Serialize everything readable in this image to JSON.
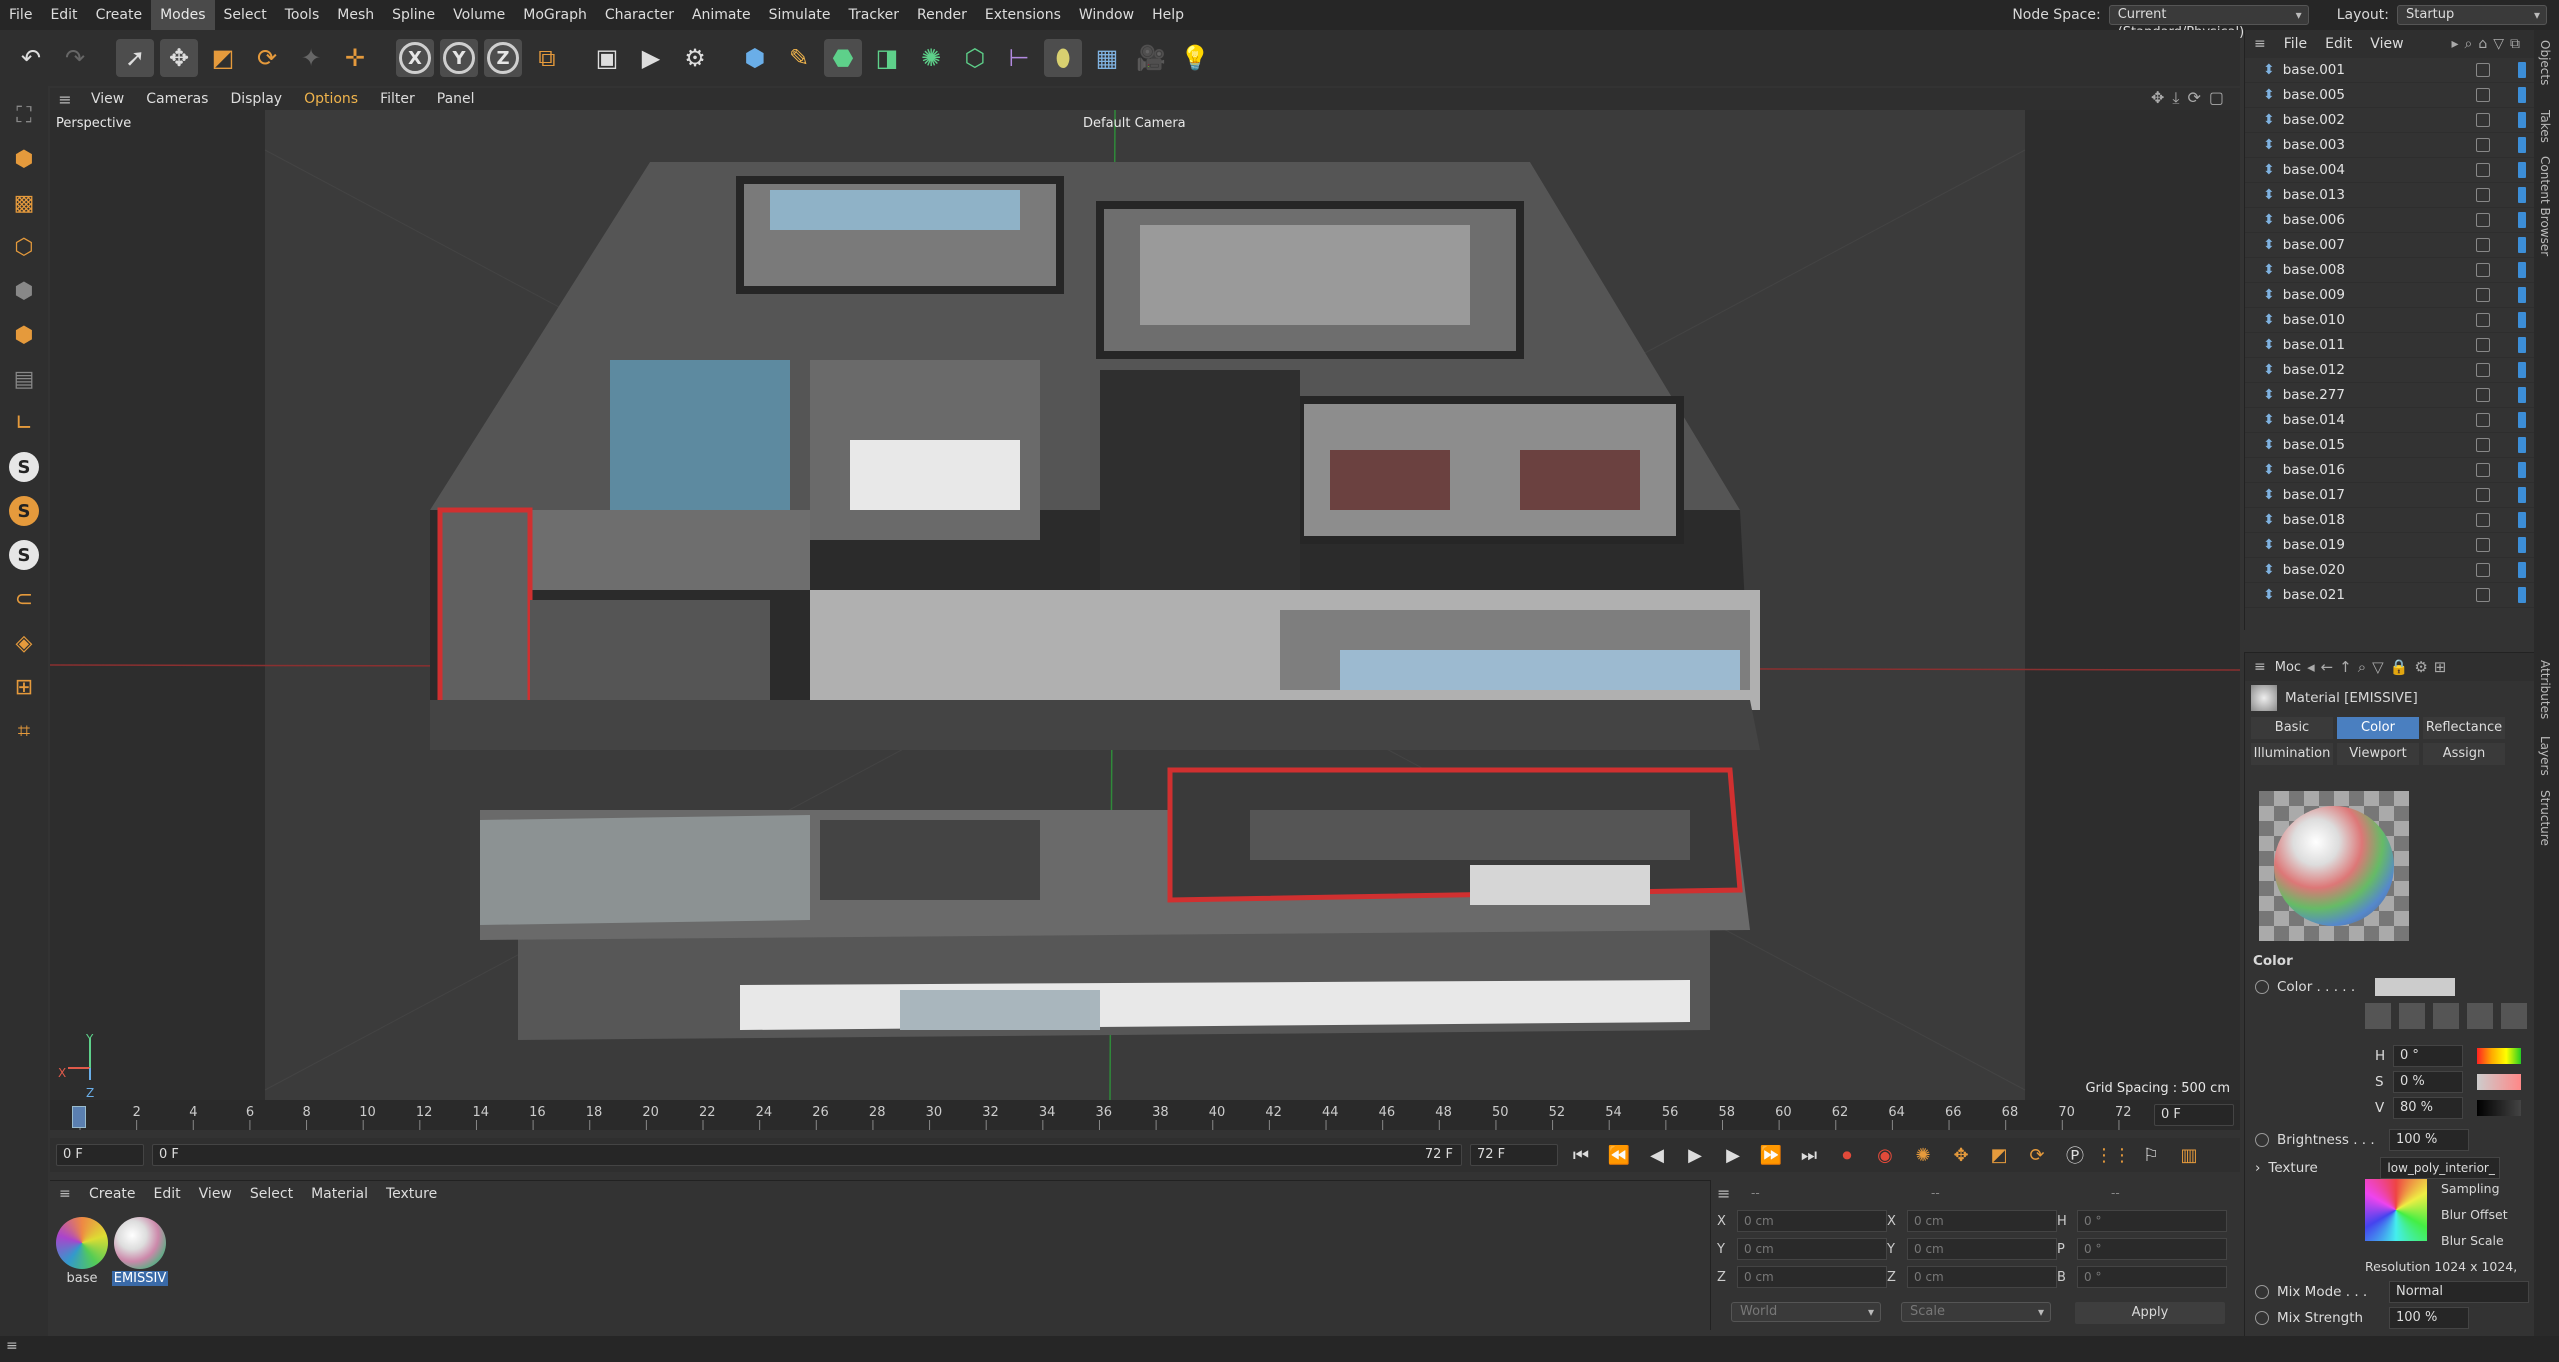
{
  "menu": {
    "items": [
      "File",
      "Edit",
      "Create",
      "Modes",
      "Select",
      "Tools",
      "Mesh",
      "Spline",
      "Volume",
      "MoGraph",
      "Character",
      "Animate",
      "Simulate",
      "Tracker",
      "Render",
      "Extensions",
      "Window",
      "Help"
    ],
    "active_index": 3,
    "node_space_label": "Node Space:",
    "node_space_value": "Current (Standard/Physical)",
    "layout_label": "Layout:",
    "layout_value": "Startup"
  },
  "viewport": {
    "menu": [
      "View",
      "Cameras",
      "Display",
      "Options",
      "Filter",
      "Panel"
    ],
    "highlight_index": 3,
    "view_name": "Perspective",
    "camera_name": "Default Camera",
    "grid_spacing": "Grid Spacing : 500 cm"
  },
  "timeline": {
    "ticks": [
      "0",
      "2",
      "4",
      "6",
      "8",
      "10",
      "12",
      "14",
      "16",
      "18",
      "20",
      "22",
      "24",
      "26",
      "28",
      "30",
      "32",
      "34",
      "36",
      "38",
      "40",
      "42",
      "44",
      "46",
      "48",
      "50",
      "52",
      "54",
      "56",
      "58",
      "60",
      "62",
      "64",
      "66",
      "68",
      "70",
      "72"
    ],
    "current_frame": "0 F",
    "start_frame": "0 F",
    "start_frame2": "0 F",
    "end_frame": "72 F",
    "end_frame2": "72 F"
  },
  "material_manager": {
    "menu": [
      "Create",
      "Edit",
      "View",
      "Select",
      "Material",
      "Texture"
    ],
    "materials": [
      {
        "name": "base",
        "selected": false
      },
      {
        "name": "EMISSIV",
        "selected": true
      }
    ]
  },
  "coordinates": {
    "header": "--",
    "header2": "--",
    "header3": "--",
    "pos": [
      {
        "axis": "X",
        "value": "0 cm"
      },
      {
        "axis": "Y",
        "value": "0 cm"
      },
      {
        "axis": "Z",
        "value": "0 cm"
      }
    ],
    "size": [
      {
        "axis": "X",
        "value": "0 cm"
      },
      {
        "axis": "Y",
        "value": "0 cm"
      },
      {
        "axis": "Z",
        "value": "0 cm"
      }
    ],
    "rot": [
      {
        "axis": "H",
        "value": "0 °"
      },
      {
        "axis": "P",
        "value": "0 °"
      },
      {
        "axis": "B",
        "value": "0 °"
      }
    ],
    "mode1": "World",
    "mode2": "Scale",
    "apply_label": "Apply"
  },
  "object_manager": {
    "menu": [
      "File",
      "Edit",
      "View"
    ],
    "objects": [
      "base.001",
      "base.005",
      "base.002",
      "base.003",
      "base.004",
      "base.013",
      "base.006",
      "base.007",
      "base.008",
      "base.009",
      "base.010",
      "base.011",
      "base.012",
      "base.277",
      "base.014",
      "base.015",
      "base.016",
      "base.017",
      "base.018",
      "base.019",
      "base.020",
      "base.021"
    ]
  },
  "attributes": {
    "mode_label": "Moc",
    "title": "Material [EMISSIVE]",
    "tabs": [
      "Basic",
      "Color",
      "Reflectance",
      "Illumination",
      "Viewport",
      "Assign"
    ],
    "selected_tab": 1,
    "section": "Color",
    "color_label": "Color . . . . .",
    "h_label": "H",
    "h_value": "0 °",
    "s_label": "S",
    "s_value": "0 %",
    "v_label": "V",
    "v_value": "80 %",
    "brightness_label": "Brightness . . .",
    "brightness_value": "100 %",
    "texture_label": "Texture",
    "texture_value": "low_poly_interior_",
    "sampling": "Sampling",
    "blur_offset": "Blur Offset",
    "blur_scale": "Blur Scale",
    "resolution": "Resolution 1024 x 1024,",
    "mix_mode_label": "Mix Mode . . .",
    "mix_mode_value": "Normal",
    "mix_strength_label": "Mix Strength",
    "mix_strength_value": "100 %"
  },
  "side_tabs": [
    "Objects",
    "Takes",
    "Content Browser",
    "Attributes",
    "Layers",
    "Structure"
  ]
}
